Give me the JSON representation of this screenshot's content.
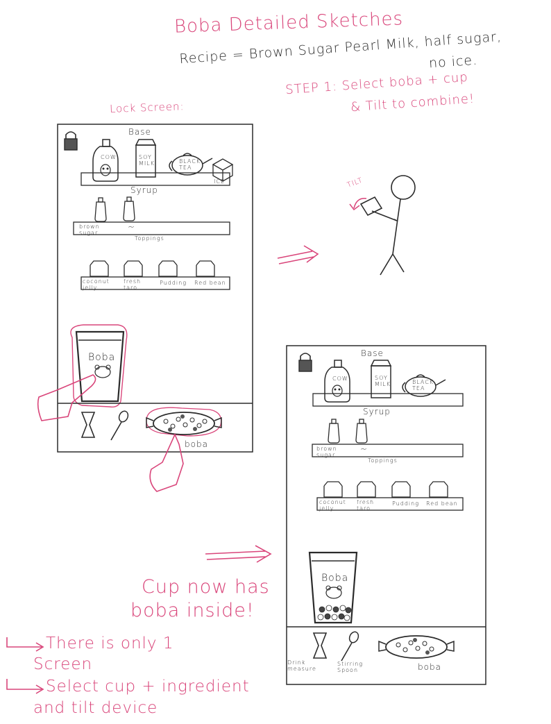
{
  "title": "Boba Detailed Sketches",
  "recipe": {
    "line1": "Recipe = Brown Sugar Pearl Milk, half sugar,",
    "line2": "no ice."
  },
  "step1": {
    "line1": "STEP 1: Select boba + cup",
    "line2": "& Tilt to combine!"
  },
  "lock_screen_label": "Lock Screen:",
  "tilt_label": "TILT",
  "screen": {
    "base_title": "Base",
    "base_items": [
      "COW",
      "SOY MILK",
      "BLACK TEA",
      "ICE"
    ],
    "syrup_title": "Syrup",
    "syrup_items": [
      "brown sugar",
      "~"
    ],
    "toppings_title": "Toppings",
    "toppings_items": [
      "coconut jelly",
      "fresh taro",
      "Pudding",
      "Red bean"
    ],
    "cup_label": "Boba",
    "tray_label": "boba",
    "drink_measure_label": "Drink measure",
    "stirring_spoon_label": "Stirring Spoon"
  },
  "cup_note": {
    "line1": "Cup now has",
    "line2": "boba inside!"
  },
  "bullets": {
    "b1_line1": "There is only 1",
    "b1_line2": "Screen",
    "b2_line1": "Select cup + ingredient",
    "b2_line2": "and tilt device"
  },
  "colors": {
    "accent": "#d9457a",
    "ink": "#2b2b2b"
  }
}
